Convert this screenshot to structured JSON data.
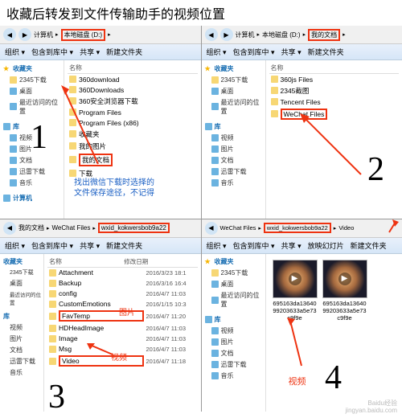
{
  "title": "收藏后转发到文件传输助手的视频位置",
  "toolbar": {
    "org": "组织 ▾",
    "inc": "包含到库中 ▾",
    "share": "共享 ▾",
    "newf": "新建文件夹",
    "slide": "放映幻灯片"
  },
  "crumbs": {
    "computer": "计算机",
    "d": "本地磁盘 (D:)",
    "mydocs": "我的文档",
    "wechat": "WeChat Files",
    "wxid": "wxid_kokwersbob9a22",
    "video": "Video"
  },
  "sidebar": {
    "fav": "收藏夹",
    "dl2345": "2345下载",
    "desktop": "桌面",
    "recent": "最近访问的位置",
    "lib": "库",
    "videos": "视频",
    "pics": "图片",
    "docs": "文档",
    "xunlei": "迅雷下载",
    "music": "音乐",
    "computer": "计算机"
  },
  "cols": {
    "name": "名称",
    "date": "修改日期"
  },
  "p1": {
    "files": [
      "360download",
      "360Downloads",
      "360安全浏览器下载",
      "Program Files",
      "Program Files (x86)",
      "收藏夹",
      "我的图片",
      "我的文档",
      "下载"
    ],
    "highlight": "我的文档",
    "note": "找出微信下载时选择的\n文件保存途径，不记得",
    "num": "1"
  },
  "p2": {
    "files": [
      "360js Files",
      "2345截图",
      "Tencent Files",
      "WeChat Files"
    ],
    "highlight": "WeChat Files",
    "num": "2"
  },
  "p3": {
    "files": [
      {
        "n": "Attachment",
        "d": "2016/3/23 18:1"
      },
      {
        "n": "Backup",
        "d": "2016/3/16 16:4"
      },
      {
        "n": "config",
        "d": "2016/4/7 11:03"
      },
      {
        "n": "CustomEmotions",
        "d": "2016/1/15 10:3"
      },
      {
        "n": "FavTemp",
        "d": "2016/4/7 11:20"
      },
      {
        "n": "HDHeadImage",
        "d": "2016/4/7 11:03"
      },
      {
        "n": "Image",
        "d": "2016/4/7 11:03"
      },
      {
        "n": "Msg",
        "d": "2016/4/7 11:03"
      },
      {
        "n": "Video",
        "d": "2016/4/7 11:18"
      }
    ],
    "hl_img": "FavTemp",
    "lbl_img": "图片",
    "hl_vid": "Video",
    "lbl_vid": "视频",
    "num": "3"
  },
  "p4": {
    "thumbs": [
      {
        "n": "695163da1364099203633a5e73c9f9e"
      },
      {
        "n": "695163da1364099203633a5e73c9f9e"
      }
    ],
    "lbl_vid": "视频",
    "num": "4"
  },
  "watermark": {
    "brand": "Baidu经验",
    "url": "jingyan.baidu.com"
  }
}
